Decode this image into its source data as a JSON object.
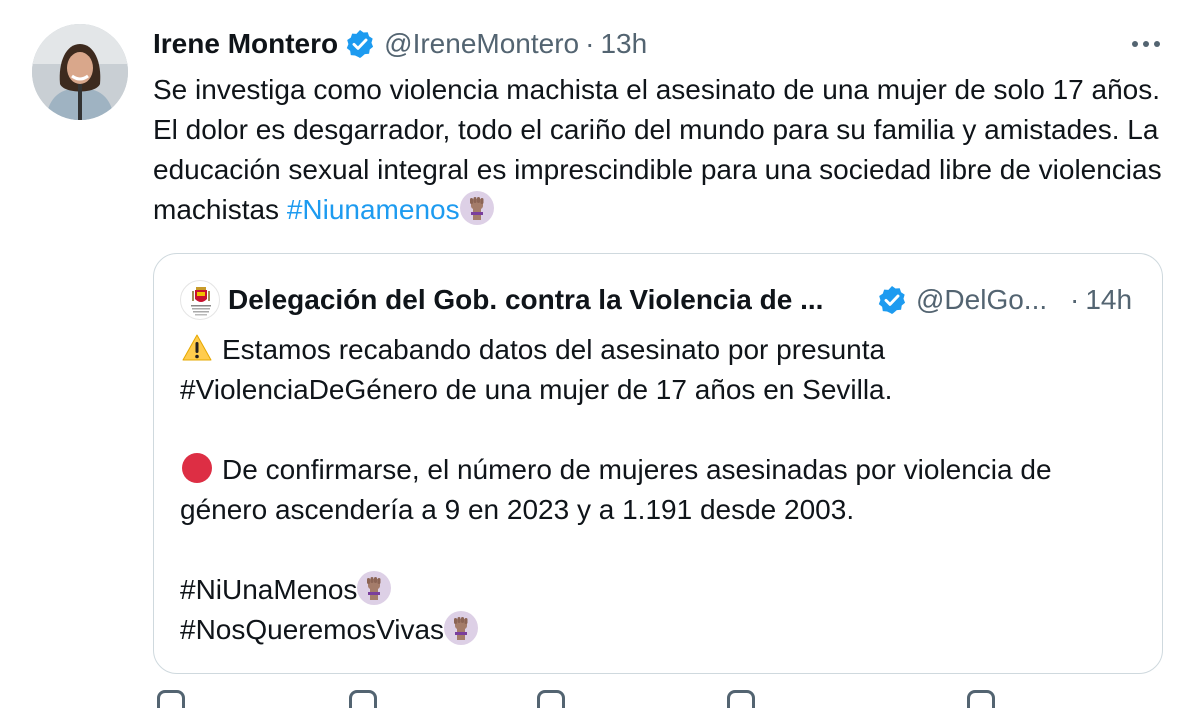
{
  "tweet": {
    "author": {
      "name": "Irene Montero",
      "handle": "@IreneMontero",
      "separator": "·",
      "time": "13h",
      "verified_icon": "verified-badge-icon",
      "avatar": "author-avatar"
    },
    "more_icon": "more-options-icon",
    "text_plain": "Se investiga como violencia machista el asesinato de una mujer de solo 17 años. El dolor es desgarrador, todo el cariño del mundo para su familia y amistades. La educación sexual integral es imprescindible para una sociedad libre de violencias machistas ",
    "hashtag": "#Niunamenos",
    "hashtag_emoji": "raised-fist-icon",
    "colors": {
      "text": "#0f1419",
      "secondary": "#536471",
      "link": "#1d9bf0",
      "border": "#cfd9de",
      "verified": "#1d9bf0"
    }
  },
  "quote": {
    "author": {
      "name": "Delegación del Gob. contra la Violencia de ...",
      "handle": "@DelGo...",
      "separator": "·",
      "time": "14h",
      "verified_icon": "verified-badge-icon",
      "avatar": "government-seal-avatar"
    },
    "lines": {
      "line1": "Estamos recabando datos del asesinato por presunta",
      "line2": "#ViolenciaDeGénero de una mujer de 17 años en Sevilla.",
      "line3": "De confirmarse, el número de mujeres asesinadas por violencia de",
      "line4": "género ascendería a 9 en 2023 y a 1.191 desde 2003.",
      "hashtag1": "#NiUnaMenos",
      "hashtag2": "#NosQueremosVivas"
    },
    "icons": {
      "warning": "warning-icon",
      "red_circle": "red-circle-icon",
      "fist": "raised-fist-icon"
    }
  },
  "actions": [
    "reply-icon",
    "retweet-icon",
    "like-icon",
    "views-icon",
    "share-icon"
  ]
}
